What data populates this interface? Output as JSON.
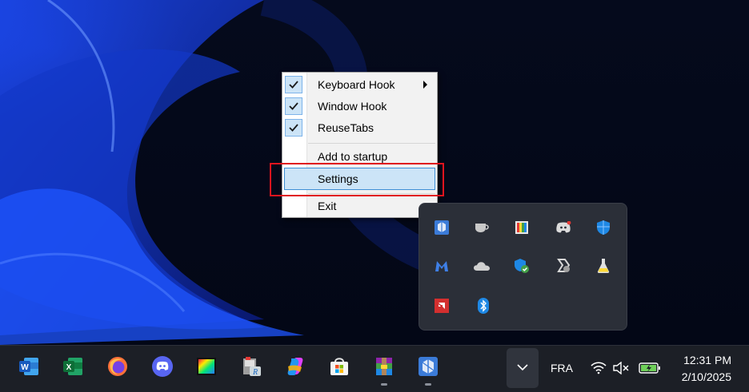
{
  "context_menu": {
    "items": [
      {
        "label": "Keyboard Hook",
        "checked": true,
        "submenu": true
      },
      {
        "label": "Window Hook",
        "checked": true
      },
      {
        "label": "ReuseTabs",
        "checked": true
      },
      {
        "label": "Add to startup",
        "checked": false
      },
      {
        "label": "Settings",
        "checked": false,
        "highlighted": true
      },
      {
        "label": "Exit",
        "checked": false
      }
    ]
  },
  "tray_overflow": {
    "icons": [
      "app-cube-icon",
      "tea-cup-icon",
      "color-palette-icon",
      "discord-icon",
      "windows-defender-icon",
      "malwarebytes-icon",
      "onedrive-icon",
      "security-shield-check-icon",
      "sync-app-icon",
      "flask-icon",
      "amd-icon",
      "bluetooth-icon"
    ]
  },
  "taskbar": {
    "apps": [
      "word-icon",
      "excel-icon",
      "firefox-icon",
      "discord-icon",
      "color-bars-icon",
      "printer-app-icon",
      "copilot-icon",
      "store-icon",
      "winrar-icon",
      "app-cube-icon"
    ],
    "language": "FRA",
    "time": "12:31 PM",
    "date": "2/10/2025"
  },
  "colors": {
    "highlight": "#cce4f7",
    "annotation": "#e0141e",
    "taskbar": "#1c1f26"
  }
}
